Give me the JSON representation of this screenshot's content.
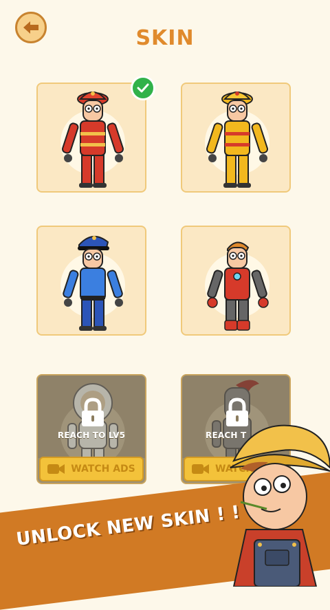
{
  "header": {
    "title": "SKIN"
  },
  "skins": [
    {
      "id": "firefighter-red",
      "selected": true,
      "locked": false
    },
    {
      "id": "firefighter-yellow",
      "selected": false,
      "locked": false
    },
    {
      "id": "police",
      "selected": false,
      "locked": false
    },
    {
      "id": "ironman",
      "selected": false,
      "locked": false
    },
    {
      "id": "astronaut",
      "selected": false,
      "locked": true,
      "lock_text": "REACH TO LV5",
      "watch_label": "WATCH ADS"
    },
    {
      "id": "knight",
      "selected": false,
      "locked": true,
      "lock_text": "REACH T",
      "watch_label": "WATCH"
    }
  ],
  "promo": {
    "banner_text": "UNLOCK NEW SKIN ! !"
  },
  "colors": {
    "accent": "#e08a2c",
    "banner": "#d17a24",
    "card_bg": "#fbe8c4",
    "check": "#31b24a"
  }
}
